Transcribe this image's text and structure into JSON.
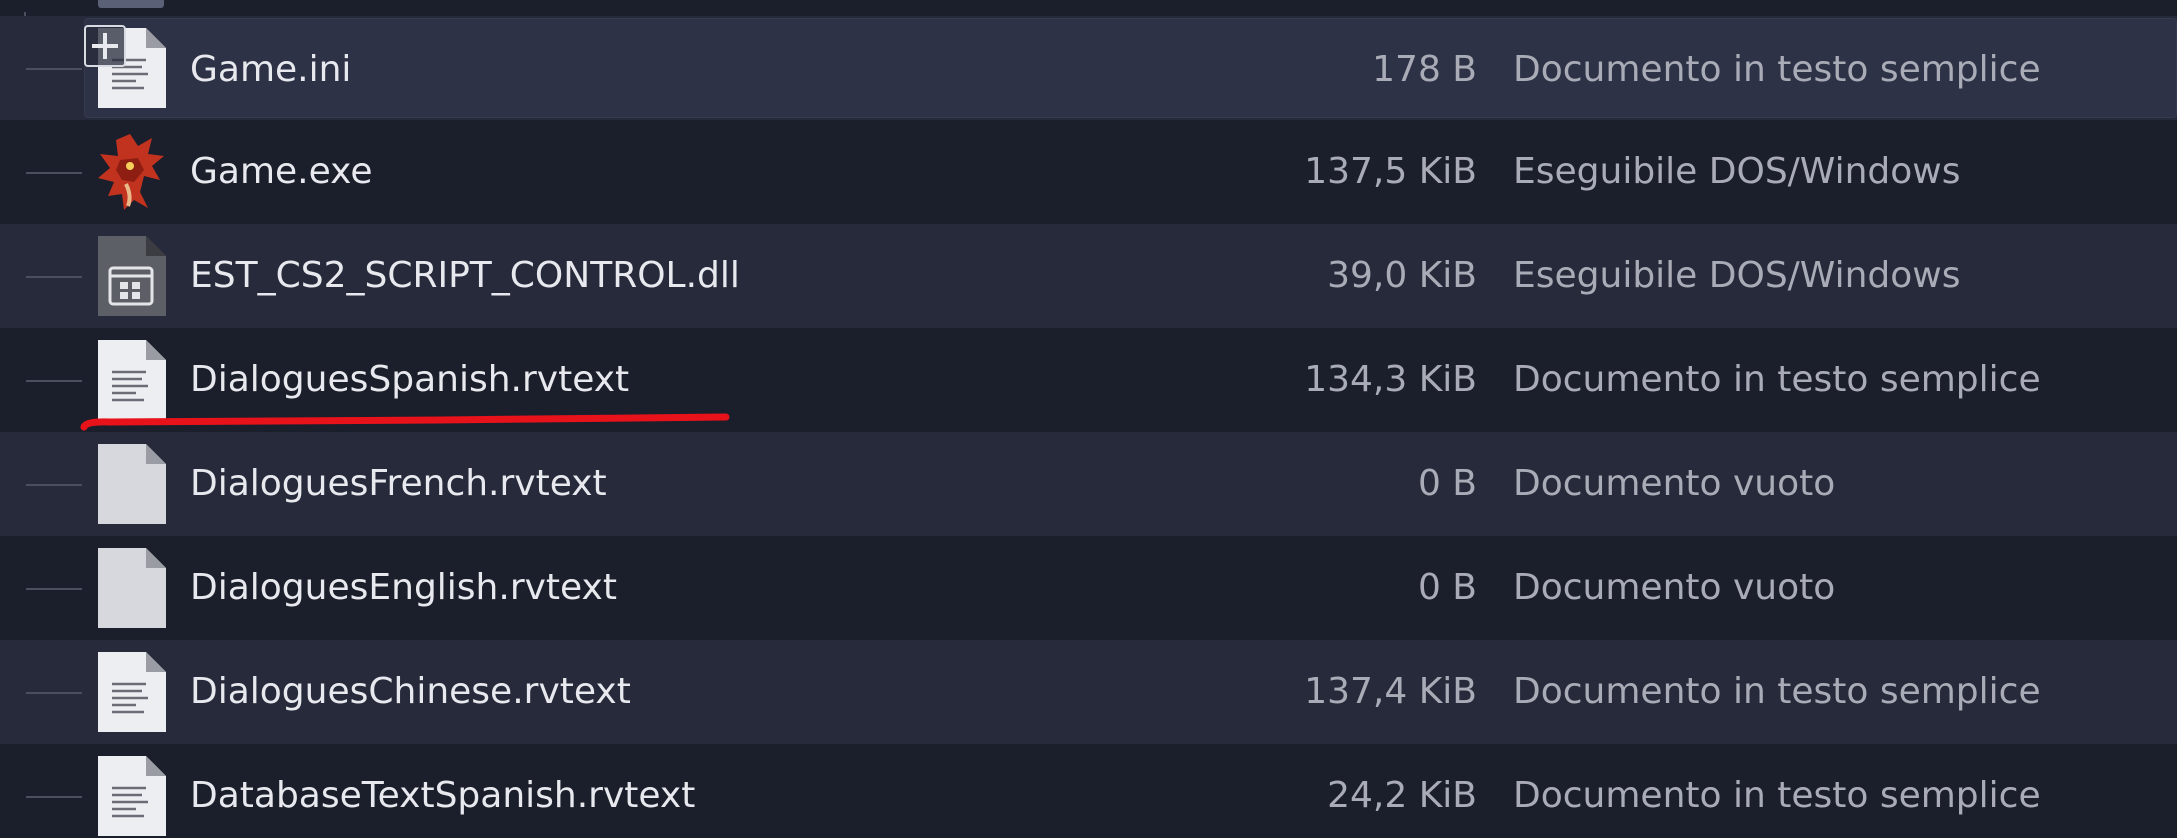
{
  "files": [
    {
      "name": "Game.ini",
      "size": "178 B",
      "type": "Documento in testo semplice",
      "icon": "text-file-icon"
    },
    {
      "name": "Game.exe",
      "size": "137,5 KiB",
      "type": "Eseguibile DOS/Windows",
      "icon": "dragon-app-icon"
    },
    {
      "name": "EST_CS2_SCRIPT_CONTROL.dll",
      "size": "39,0 KiB",
      "type": "Eseguibile DOS/Windows",
      "icon": "dll-library-icon"
    },
    {
      "name": "DialoguesSpanish.rvtext",
      "size": "134,3 KiB",
      "type": "Documento in testo semplice",
      "icon": "text-file-icon"
    },
    {
      "name": "DialoguesFrench.rvtext",
      "size": "0 B",
      "type": "Documento vuoto",
      "icon": "empty-file-icon"
    },
    {
      "name": "DialoguesEnglish.rvtext",
      "size": "0 B",
      "type": "Documento vuoto",
      "icon": "empty-file-icon"
    },
    {
      "name": "DialoguesChinese.rvtext",
      "size": "137,4 KiB",
      "type": "Documento in testo semplice",
      "icon": "text-file-icon"
    },
    {
      "name": "DatabaseTextSpanish.rvtext",
      "size": "24,2 KiB",
      "type": "Documento in testo semplice",
      "icon": "text-file-icon"
    }
  ],
  "colors": {
    "background": "#1b1e2b",
    "alternate_row": "#262a3b",
    "hover_row": "#2e3246",
    "text_primary": "#e8e9ee",
    "text_secondary": "#a9abb6",
    "annotation": "#e8121a"
  }
}
